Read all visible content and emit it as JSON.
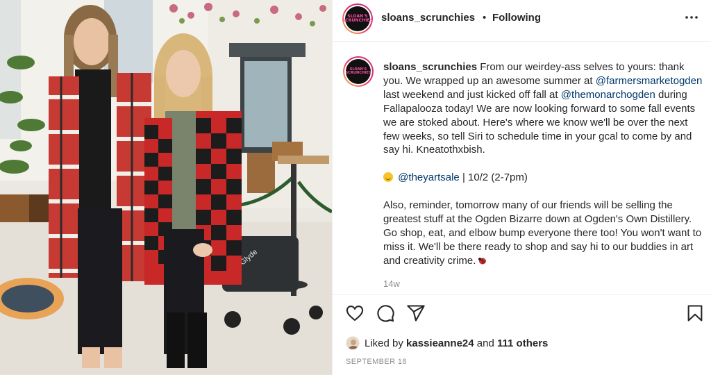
{
  "header": {
    "username": "sloans_scrunchies",
    "separator": "•",
    "follow_status": "Following",
    "more_icon": "more-horizontal-icon",
    "avatar_logo": [
      "SLOAN'S",
      "SCRUNCHIES"
    ]
  },
  "photo": {
    "description_icon": "post-photo",
    "stroller_text": "weeGlyde"
  },
  "caption": {
    "username": "sloans_scrunchies",
    "p1_a": "From our weirdey-ass selves to yours: thank you. We wrapped up an awesome summer at",
    "mention1": "@farmersmarketogden",
    "p1_b": "last weekend and just kicked off fall at",
    "mention2": "@themonarchogden",
    "p1_c": "during Fallapalooza today! We are now looking forward to some fall events we are stoked about. Here's where we know we'll be over the next few weeks, so tell Siri to schedule time in your gcal to come by and say hi. Kneatothxbish.",
    "mention3": "@theyartsale",
    "event": "| 10/2 (2-7pm)",
    "p3": "Also, reminder, tomorrow many of our friends will be selling the greatest stuff at the Ogden Bizarre down at Ogden's Own Distillery. Go shop, eat, and elbow bump everyone there too! You won't want to miss it. We'll be there ready to shop and say hi to our buddies in art and creativity crime.",
    "time_ago": "14w"
  },
  "actions": {
    "like_icon": "heart-icon",
    "comment_icon": "comment-icon",
    "share_icon": "share-icon",
    "save_icon": "bookmark-icon"
  },
  "likes": {
    "prefix": "Liked by",
    "user": "kassieanne24",
    "conj": "and",
    "others": "111 others"
  },
  "post_date": "SEPTEMBER 18",
  "colors": {
    "mention": "#00376b",
    "muted": "#8e8e8e",
    "brand_pink": "#ff4fa3"
  }
}
